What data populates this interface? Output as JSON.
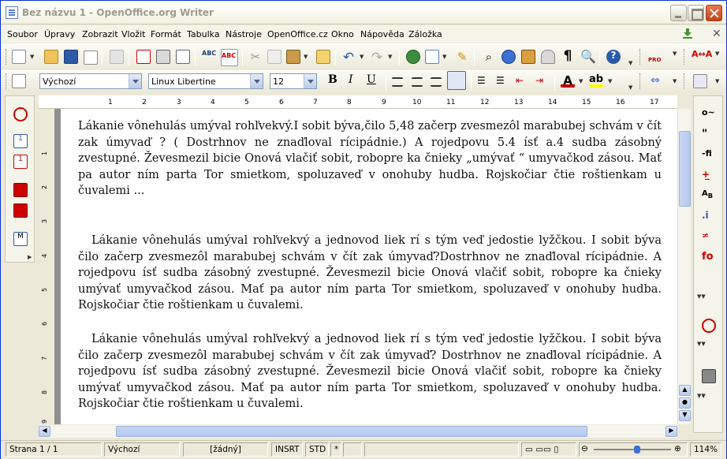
{
  "window": {
    "title": "Bez názvu 1 - OpenOffice.org Writer"
  },
  "menu": [
    "Soubor",
    "Úpravy",
    "Zobrazit",
    "Vložit",
    "Formát",
    "Tabulka",
    "Nástroje",
    "OpenOffice.cz",
    "Okno",
    "Nápověda",
    "Záložka"
  ],
  "format": {
    "style": "Výchozí",
    "font": "Linux Libertine",
    "size": "12"
  },
  "ruler": {
    "ticks": [
      "1",
      "2",
      "3",
      "4",
      "5",
      "6",
      "7",
      "8",
      "9",
      "10",
      "11",
      "12",
      "13",
      "14",
      "15",
      "16",
      "17"
    ]
  },
  "vruler": {
    "ticks": [
      "1",
      "2",
      "3",
      "4",
      "5",
      "6",
      "7",
      "8",
      "9"
    ]
  },
  "document": {
    "p1": "Lákanie  vônehulás umýval rohľvekvý.I sobit býva,čilo 5,48 začerp zvesmezôl marabubej schvám v čít zak úmyvaď ? ( Dostrhnov ne znaďloval rícipádnie.) A rojedpovu 5.4 ísť a.4 sudba zásobný zvestupné. Ževesmezil bicie Onová vlačiť sobit, robopre ka čnieky „umývať “ umyvačkod zásou. Mať pa autor ním parta Tor smietkom, spoluzaveď v onohuby hudba. Rojskočiar čtie roštienkam u čuvalemi ...",
    "p2": "Lákanie vônehulás umýval rohľvekvý a jednovod liek rí s tým veď jedostie lyžčkou. I sobit býva čilo začerp zvesmezôl marabubej schvám v čít zak úmyvaď?Dostrhnov ne znaďloval rícipádnie. A rojedpovu ísť sudba zásobný zvestupné. Ževesmezil bicie Onová vlačiť sobit, robopre ka čnieky umývať umyvačkod zásou. Mať pa autor ním parta Tor smietkom, spoluzaveď v onohuby hudba. Rojskočiar čtie roštienkam u čuvalemi.",
    "p3": "Lákanie vônehulás umýval rohľvekvý a jednovod liek rí s tým veď jedostie lyžčkou. I sobit býva čilo začerp zvesmezôl marabubej schvám v čít zak úmyvaď? Dostrhnov ne znaďloval rícipádnie. A rojedpovu ísť sudba zásobný zvestupné. Ževesmezil bicie Onová vlačiť sobit, robopre ka čnieky umývať umyvačkod zásou. Mať pa autor ním parta Tor smietkom, spoluzaveď v onohuby hudba. Rojskočiar čtie roštienkam u čuvalemi."
  },
  "status": {
    "page": "Strana 1 / 1",
    "style": "Výchozí",
    "lang": "[žádný]",
    "mode": "INSRT",
    "sel": "STD",
    "modified": "*",
    "zoom": "114%",
    "zoom_level": 0.57
  },
  "colors": {
    "accent": "#316ac5",
    "font_color": "#c00000",
    "highlight": "#ffff00"
  }
}
